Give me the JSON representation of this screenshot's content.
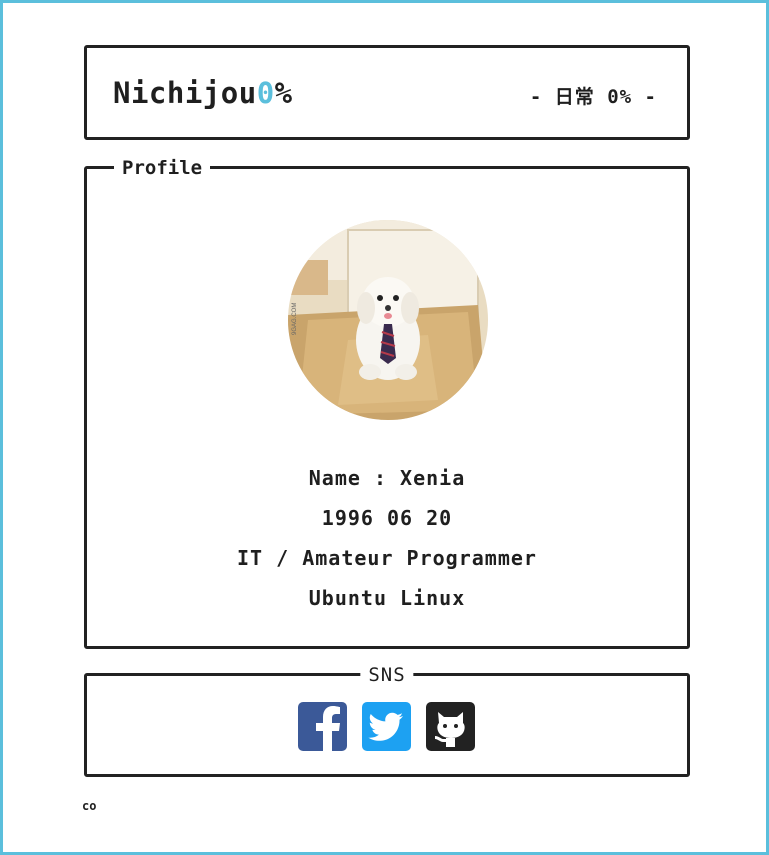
{
  "header": {
    "logo_main": "Nichijou",
    "logo_accent": "0",
    "logo_suffix": "%",
    "tagline": "- 日常 0% -"
  },
  "profile": {
    "legend": "Profile",
    "avatar_watermark": "9GAG.COM",
    "name_line": "Name : Xenia",
    "birth_line": "1996 06 20",
    "job_line": "IT / Amateur Programmer",
    "os_line": "Ubuntu Linux"
  },
  "sns": {
    "legend": "SNS",
    "icons": [
      "facebook-icon",
      "twitter-icon",
      "github-icon"
    ]
  },
  "footer": {
    "text": "co"
  },
  "colors": {
    "accent": "#5bbfdc",
    "border": "#222222",
    "facebook": "#3b5998",
    "twitter": "#1da1f2",
    "github": "#222222"
  }
}
